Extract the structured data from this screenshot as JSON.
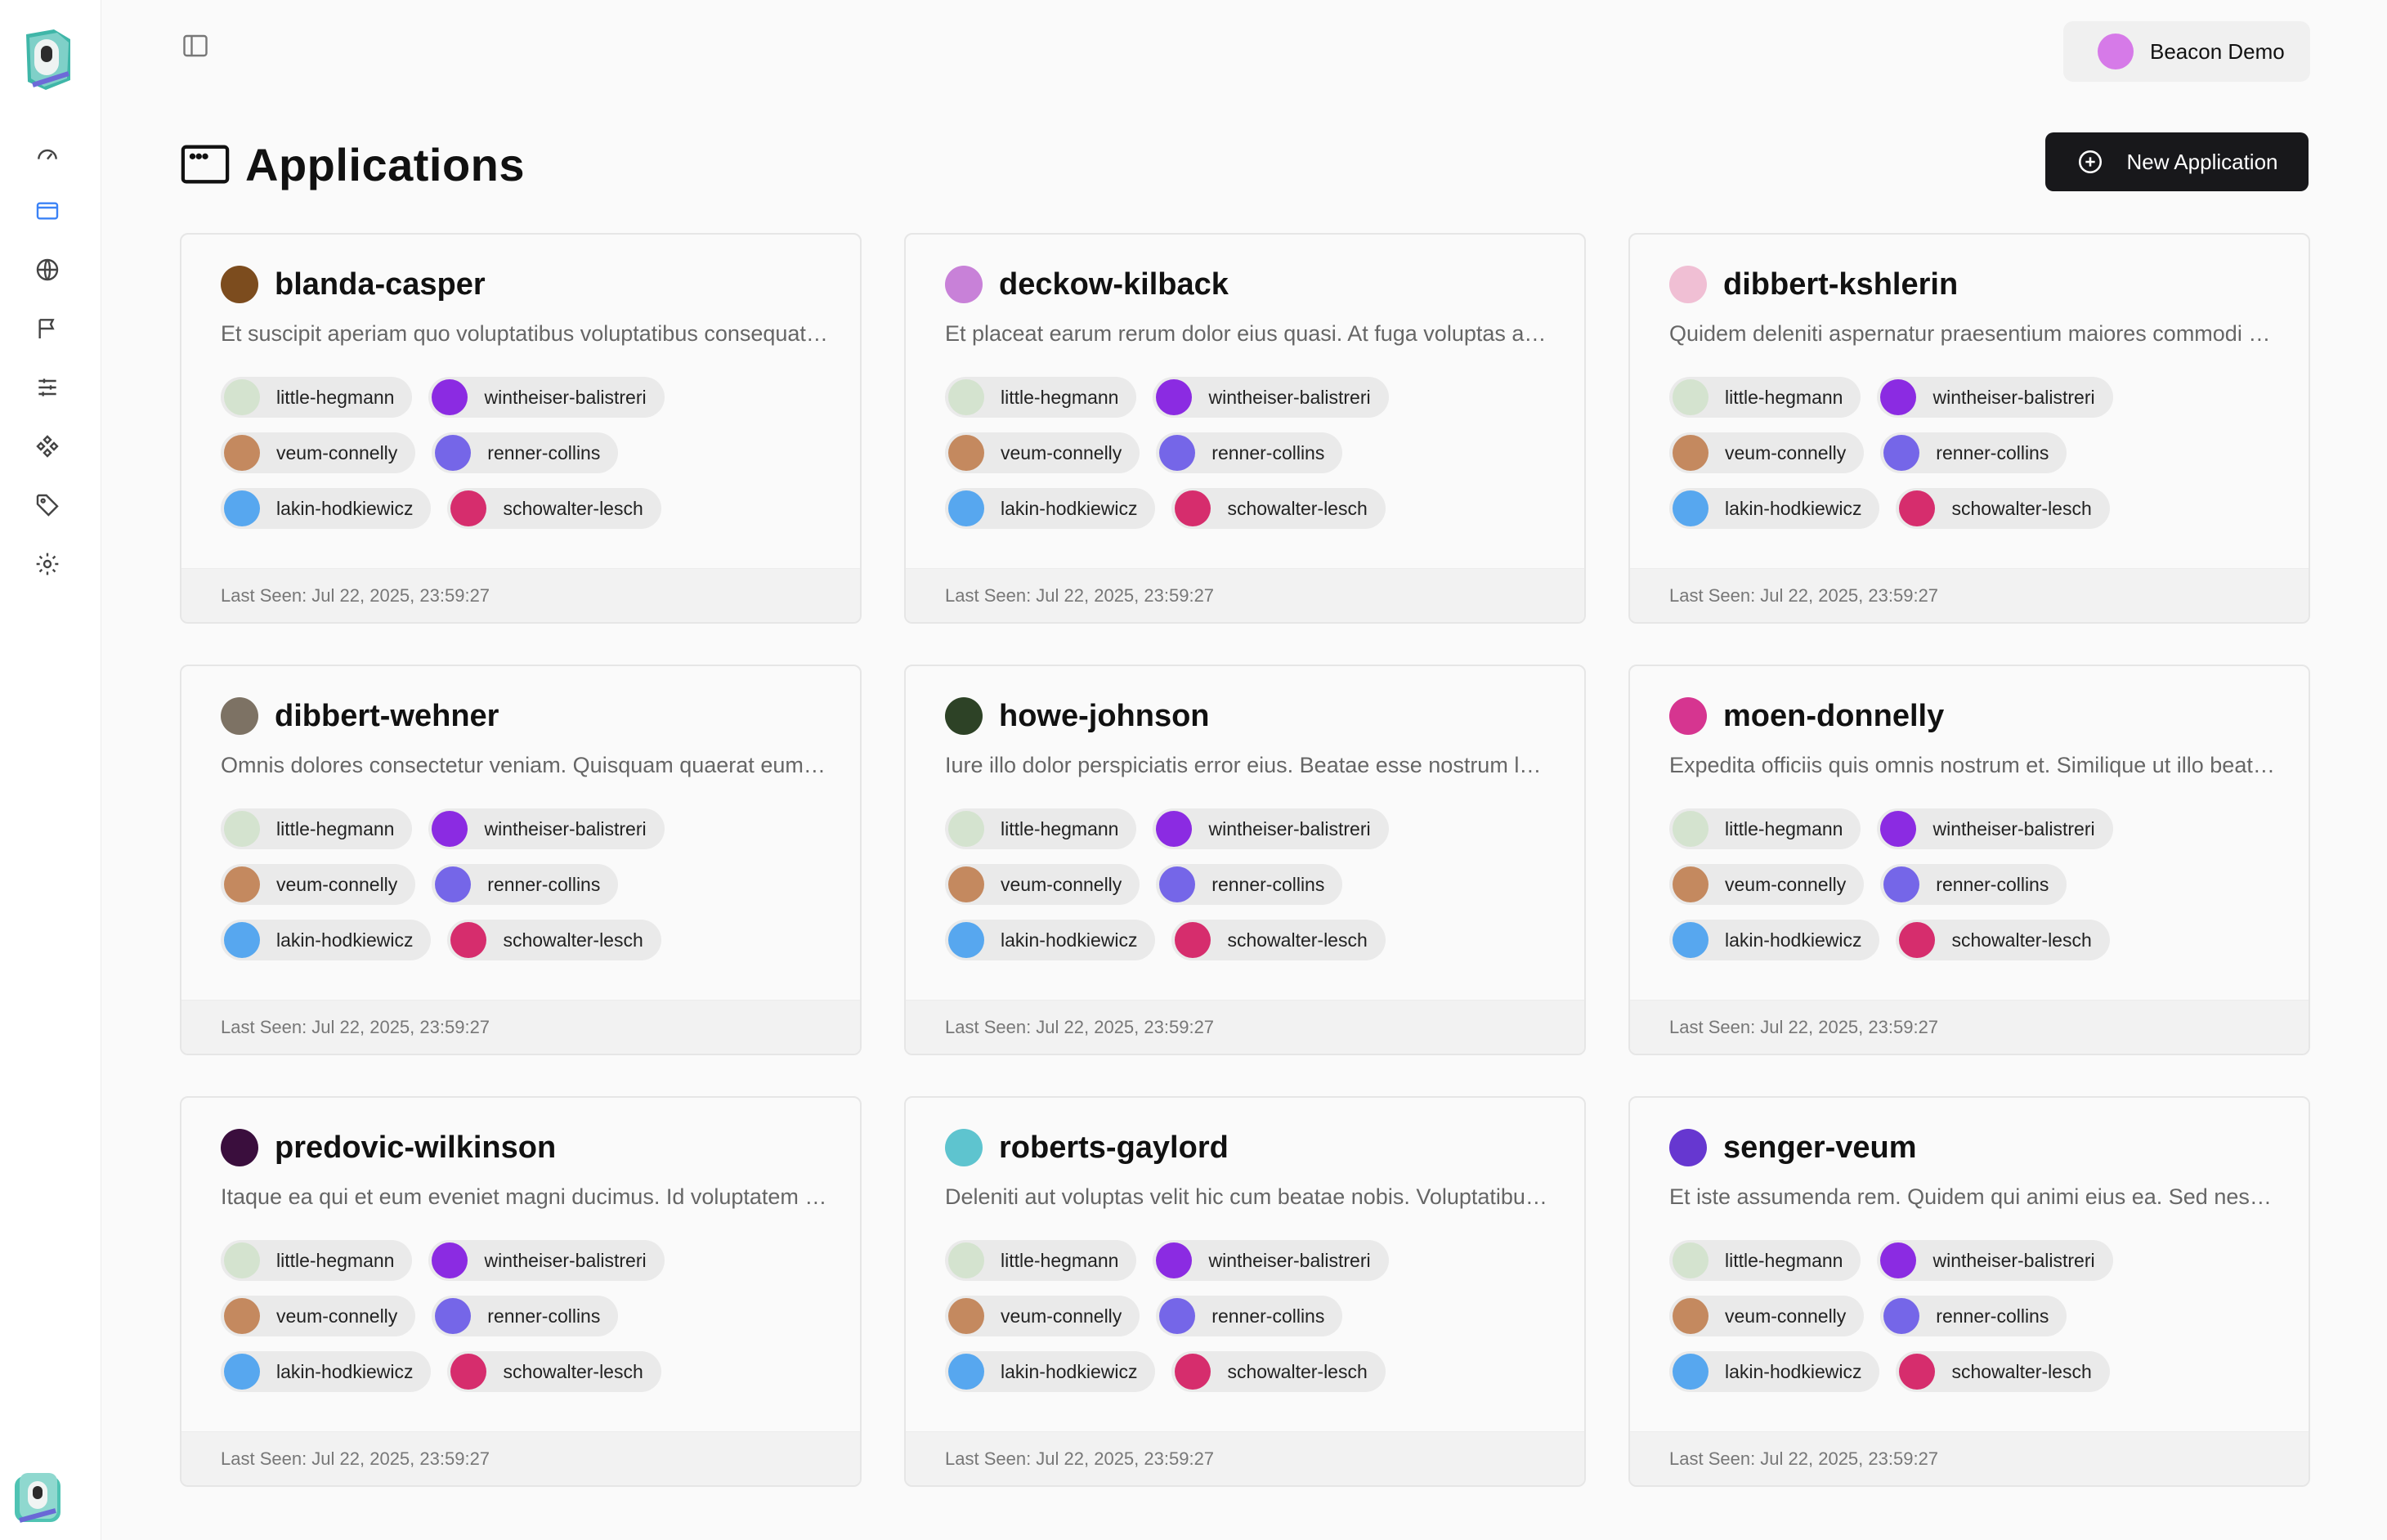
{
  "account": {
    "name": "Beacon Demo",
    "avatar_color": "#d67ae8"
  },
  "header": {
    "title": "Applications",
    "new_button": "New Application"
  },
  "sidebar": {
    "items": [
      {
        "icon": "gauge-icon"
      },
      {
        "icon": "window-icon",
        "active": true
      },
      {
        "icon": "globe-icon"
      },
      {
        "icon": "flag-icon"
      },
      {
        "icon": "sliders-icon"
      },
      {
        "icon": "components-icon"
      },
      {
        "icon": "tag-icon"
      },
      {
        "icon": "gear-icon"
      }
    ]
  },
  "environments": [
    {
      "name": "little-hegmann",
      "color": "#d4e3cf"
    },
    {
      "name": "wintheiser-balistreri",
      "color": "#8b2be2"
    },
    {
      "name": "veum-connelly",
      "color": "#c4895f"
    },
    {
      "name": "renner-collins",
      "color": "#7566e8"
    },
    {
      "name": "lakin-hodkiewicz",
      "color": "#57a7ef"
    },
    {
      "name": "schowalter-lesch",
      "color": "#d62d6d"
    }
  ],
  "last_seen_label": "Last Seen: Jul 22, 2025, 23:59:27",
  "applications": [
    {
      "name": "blanda-casper",
      "color": "#7c4c1e",
      "description": "Et suscipit aperiam quo voluptatibus voluptatibus consequat…"
    },
    {
      "name": "deckow-kilback",
      "color": "#c881d8",
      "description": "Et placeat earum rerum dolor eius quasi. At fuga voluptas acc…"
    },
    {
      "name": "dibbert-kshlerin",
      "color": "#f0bfd4",
      "description": "Quidem deleniti aspernatur praesentium maiores commodi …"
    },
    {
      "name": "dibbert-wehner",
      "color": "#7d7264",
      "description": "Omnis dolores consectetur veniam. Quisquam quaerat eum l…"
    },
    {
      "name": "howe-johnson",
      "color": "#2d4226",
      "description": "Iure illo dolor perspiciatis error eius. Beatae esse nostrum la…"
    },
    {
      "name": "moen-donnelly",
      "color": "#d63590",
      "description": "Expedita officiis quis omnis nostrum et. Similique ut illo beat…"
    },
    {
      "name": "predovic-wilkinson",
      "color": "#3a0e3d",
      "description": "Itaque ea qui et eum eveniet magni ducimus. Id voluptatem v…"
    },
    {
      "name": "roberts-gaylord",
      "color": "#5ec4cf",
      "description": "Deleniti aut voluptas velit hic cum beatae nobis. Voluptatibu…"
    },
    {
      "name": "senger-veum",
      "color": "#6637d0",
      "description": "Et iste assumenda rem. Quidem qui animi eius ea. Sed nesciu…"
    }
  ]
}
